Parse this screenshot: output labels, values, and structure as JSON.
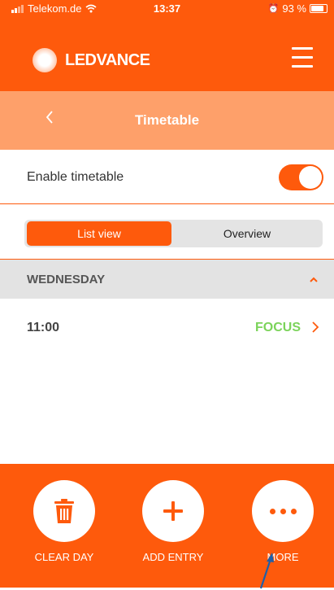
{
  "status_bar": {
    "carrier": "Telekom.de",
    "time": "13:37",
    "battery": "93 %"
  },
  "app_bar": {
    "brand": "LEDVANCE",
    "menu_icon": "hamburger-menu-icon",
    "logo_icon": "ledvance-logo-icon"
  },
  "title_bar": {
    "back_icon": "chevron-left-icon",
    "title": "Timetable"
  },
  "enable": {
    "label": "Enable timetable",
    "enabled": true
  },
  "view_switch": {
    "options": [
      "List view",
      "Overview"
    ],
    "selected": "List view"
  },
  "schedule": {
    "day": "WEDNESDAY",
    "expanded": true,
    "entries": [
      {
        "time": "11:00",
        "mode": "FOCUS"
      }
    ]
  },
  "actions": [
    {
      "label": "CLEAR DAY",
      "icon": "trash-icon"
    },
    {
      "label": "ADD ENTRY",
      "icon": "plus-icon"
    },
    {
      "label": "MORE",
      "icon": "more-dots-icon"
    }
  ],
  "colors": {
    "brand_orange": "#fe5a0c",
    "title_bar_orange": "#fea06a",
    "focus_green": "#7bd35a",
    "day_header_gray": "#e3e3e3"
  }
}
